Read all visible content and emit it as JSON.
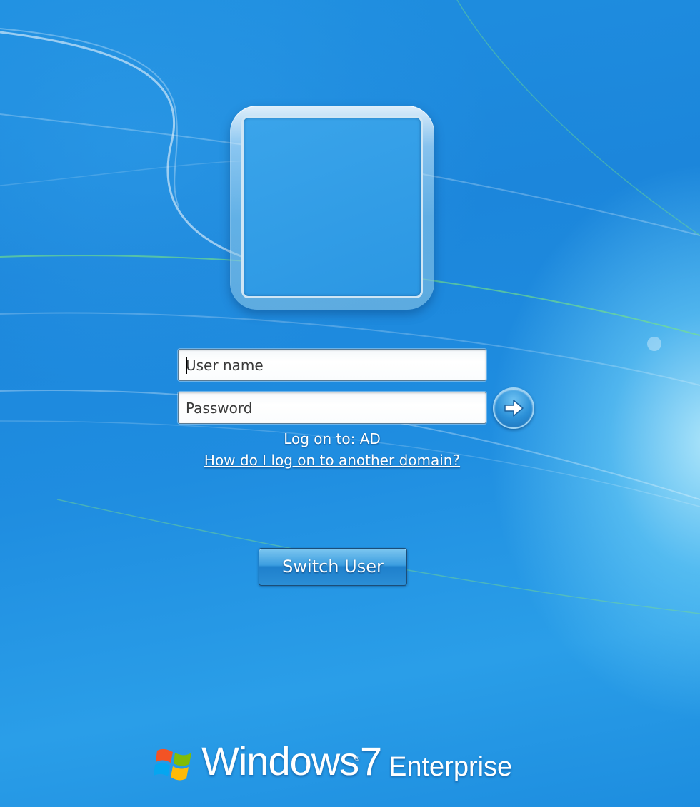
{
  "login": {
    "username_placeholder": "User name",
    "password_placeholder": "Password",
    "logon_to": "Log on to: AD",
    "domain_help_link": "How do I log on to another domain?",
    "submit_icon": "arrow-right-icon"
  },
  "actions": {
    "switch_user_label": "Switch User"
  },
  "branding": {
    "product": "Windows",
    "version": "7",
    "edition": "Enterprise",
    "logo_icon": "windows-flag-icon"
  },
  "colors": {
    "background": "#1f8fe0",
    "text": "#ffffff"
  }
}
